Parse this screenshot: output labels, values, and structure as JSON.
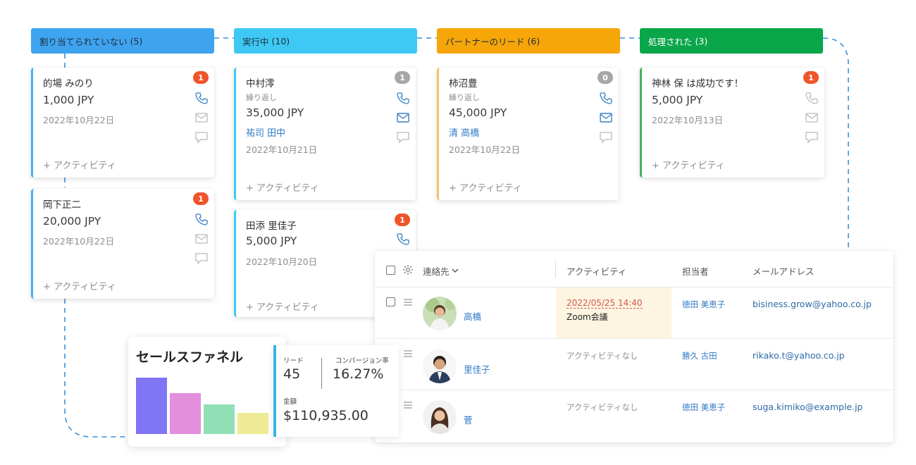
{
  "columns": [
    {
      "label": "割り当てられていない",
      "count": "(5)",
      "color": "#3fa4ef"
    },
    {
      "label": "実行中",
      "count": "(10)",
      "color": "#3ec9f4"
    },
    {
      "label": "パートナーのリード",
      "count": "(6)",
      "color": "#f6a609"
    },
    {
      "label": "処理された",
      "count": "(3)",
      "color": "#0aa64a"
    }
  ],
  "cards": {
    "c1": {
      "name": "的場 みのり",
      "badge": "1",
      "amount": "1,000 JPY",
      "date": "2022年10月22日",
      "activity": "+ アクティビティ"
    },
    "c2": {
      "name": "岡下正二",
      "badge": "1",
      "amount": "20,000 JPY",
      "date": "2022年10月22日",
      "activity": "+ アクティビティ"
    },
    "c3": {
      "name": "中村澪",
      "badge": "1",
      "sub": "繰り返し",
      "amount": "35,000 JPY",
      "person": "祐司 田中",
      "date": "2022年10月21日",
      "activity": "+ アクティビティ"
    },
    "c4": {
      "name": "田添 里佳子",
      "badge": "1",
      "amount": "5,000 JPY",
      "date": "2022年10月20日",
      "activity": "+ アクティビティ"
    },
    "c5": {
      "name": "柿沼豊",
      "badge": "0",
      "sub": "繰り返し",
      "amount": "45,000 JPY",
      "person": "清 高橋",
      "date": "2022年10月22日",
      "activity": "+ アクティビティ"
    },
    "c6": {
      "name": "神林 保 は成功です！",
      "badge": "1",
      "amount": "5,000 JPY",
      "date": "2022年10月13日",
      "activity": "+ アクティビティ"
    }
  },
  "table": {
    "headers": {
      "contact": "連絡先",
      "activity": "アクティビティ",
      "owner": "担当者",
      "email": "メールアドレス"
    },
    "rows": [
      {
        "name": "高橋",
        "activity_date": "2022/05/25 14:40",
        "activity_title": "Zoom会議",
        "owner": "徳田 美恵子",
        "email": "bisiness.grow@yahoo.co.jp"
      },
      {
        "name": "里佳子",
        "activity": "アクティビティなし",
        "owner": "勝久 古田",
        "email": "rikako.t@yahoo.co.jp"
      },
      {
        "name": "菅",
        "activity": "アクティビティなし",
        "owner": "徳田 美恵子",
        "email": "suga.kimiko@example.jp"
      }
    ]
  },
  "funnel": {
    "title": "セールスファネル",
    "bars": [
      {
        "value": 1.0,
        "color": "#8075f5"
      },
      {
        "value": 0.72,
        "color": "#e38fdd"
      },
      {
        "value": 0.53,
        "color": "#91e0b5"
      },
      {
        "value": 0.38,
        "color": "#efeb94"
      }
    ]
  },
  "stats": {
    "leads_label": "リード",
    "leads_value": "45",
    "conversion_label": "コンバージョン率",
    "conversion_value": "16.27%",
    "amount_label": "金額",
    "amount_value": "$110,935.00"
  },
  "icons": {
    "phone": "phone-icon",
    "mail": "mail-icon",
    "comment": "comment-icon",
    "gear": "gear-icon",
    "drag": "drag-handle-icon"
  }
}
